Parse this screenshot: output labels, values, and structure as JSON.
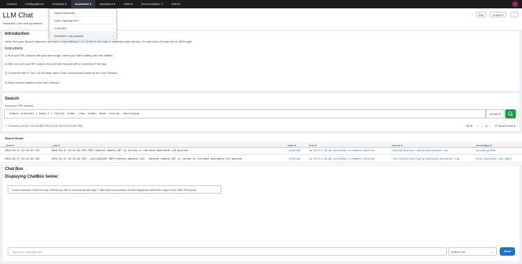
{
  "topnav": {
    "items": [
      "Content",
      "Configuration ▾",
      "Examples ▾",
      "Assistants ▾",
      "Operations ▾",
      "Other ▾",
      "Documentation ↗",
      "Search"
    ],
    "active_index": 3
  },
  "assistants_menu": {
    "items": [
      "Neural Networks",
      "Deep Learning NLP",
      "LLM-RAG",
      "Interactive Log Analysis"
    ],
    "active_index": 3
  },
  "header": {
    "title": "LLM Chat",
    "description": "Interactive LLM chat experience",
    "edit_label": "Edit",
    "export_label": "Export ▾",
    "more_label": "..."
  },
  "intro": {
    "heading": "Introduction",
    "body": "Hello! Run your Splunk Searches, and have a blast talking to a LLM about your logs or anything under the sky. Do note that LLM may not be 100% right.",
    "instructions_heading": "Instructions",
    "steps": [
      "1) Run your SPL Search with your time range, before you start chatting with the chatbot.",
      "2) After you run your SPL search, the LLM will respond with a summary of the logs.",
      "3) Converse with it! The LLM will keep track of the conversation based on the User Session.",
      "4) Each refresh creates a new User Session."
    ]
  },
  "search": {
    "heading": "Search",
    "input_label": "Input your SPL queries",
    "query": "index=_internal | head 2 | fields _time, _raw, index, host, source, sourcetype",
    "time_range": "All time ▾",
    "events_summary": "✓ 2 events (1/1/24, 3:10:06.000 PM to 3:07:26.119:09.000 PM)",
    "job_label": "Job ▾",
    "mode_label": "✦ Smart Mode ▾"
  },
  "results": {
    "heading": "Search Result",
    "columns": [
      "_time ▾",
      "_raw ▾",
      "index ▾",
      "host ▾",
      "source ▾",
      "sourcetype ▾"
    ],
    "rows": [
      [
        "2024-02-17 22:14:02.758",
        "2024-02-17 13:14:02.758 INFO handler handle_GET is called to retrieve available LLM options",
        "_internal",
        "ip-10-0-1-34.ap-northeast-1.compute.internal",
        "/opt/splunk/var/log/splunk/python.log",
        "splunk_python"
      ],
      [
        "2024-02-17 22:14:02.758",
        "2024-02-17 13:14:02.758 - pid:2423100 INFO     chatbox_handler:123 - handler handle_GET is called to retrieve available LLM options",
        "_internal",
        "ip-10-0-1-34.ap-northeast-1.compute.internal",
        "/opt/splunk/var/log/splunk/mltk-container.log",
        "mltk-container-too_small"
      ]
    ]
  },
  "chat": {
    "heading": "Chat Box",
    "subheading": "Displaying ChatBox below:",
    "message": "I have received 2 lines of logs. Would you like to summarise the logs? I will return a summary of what happened within the logs in less than 200 words.",
    "input_placeholder": "Type your message here...",
    "select_label": "Select LLM...",
    "send_label": "Send"
  },
  "colors": {
    "topnav_bg": "#1a1c20",
    "go_button": "#1a9c3e",
    "send_button": "#1a75c9",
    "link": "#006eaa"
  }
}
